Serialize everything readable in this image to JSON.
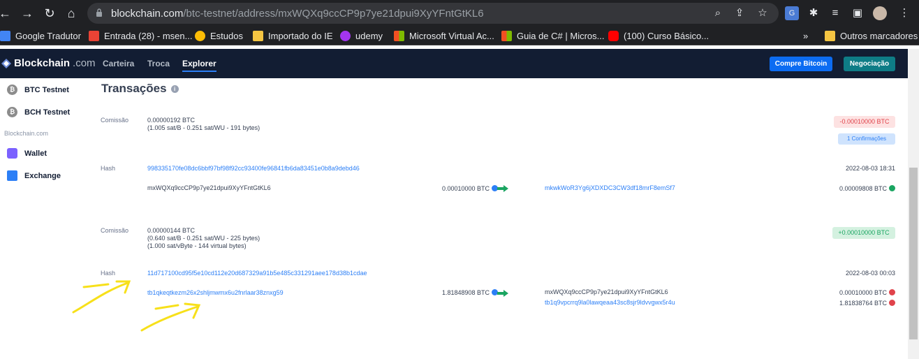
{
  "browser": {
    "url_domain": "blockchain.com",
    "url_path": "/btc-testnet/address/mxWQXq9ccCP9p7ye21dpui9XyYFntGtKL6",
    "bookmarks": [
      {
        "label": "Google Tradutor",
        "color": "#4285f4"
      },
      {
        "label": "Entrada (28) - msen...",
        "color": "#ea4335"
      },
      {
        "label": "Estudos",
        "color": "#fbbc05"
      },
      {
        "label": "Importado do IE",
        "color": "#f5c542"
      },
      {
        "label": "udemy",
        "color": "#a435f0"
      },
      {
        "label": "Microsoft Virtual Ac...",
        "color": "#f25022"
      },
      {
        "label": "Guia de C# | Micros...",
        "color": "#f25022"
      },
      {
        "label": "(100) Curso Básico...",
        "color": "#ff0000"
      }
    ],
    "more": "»",
    "other_bookmarks": "Outros marcadores"
  },
  "header": {
    "logo_a": "Blockchain",
    "logo_b": ".com",
    "nav": [
      "Carteira",
      "Troca",
      "Explorer"
    ],
    "btn_buy": "Compre Bitcoin",
    "btn_trade": "Negociação",
    "btn_buy_color": "#0c6cf2",
    "btn_trade_color": "#0e7c86"
  },
  "sidebar": {
    "items": [
      "BTC Testnet",
      "BCH Testnet"
    ],
    "section": "Blockchain.com",
    "links": [
      "Wallet",
      "Exchange"
    ]
  },
  "main": {
    "title": "Transações",
    "tx1": {
      "fee_label": "Comissão",
      "fee": "0.00000192 BTC",
      "fee_detail": "(1.005 sat/B - 0.251 sat/WU - 191 bytes)",
      "amount_badge": "-0.00010000 BTC",
      "confirmations": "1 Confirmações",
      "hash_label": "Hash",
      "hash": "998335170fe08dc6bbf97bf98f92cc93400fe96841fb6da83451e0b8a9debd46",
      "date": "2022-08-03 18:31",
      "input_addr": "mxWQXq9ccCP9p7ye21dpui9XyYFntGtKL6",
      "input_amount": "0.00010000 BTC",
      "output_addr": "mkwkWoR3Yg6jXDXDC3CW3df18mrF8emSf7",
      "output_amount": "0.00009808 BTC"
    },
    "tx2": {
      "fee_label": "Comissão",
      "fee": "0.00000144 BTC",
      "fee_detail1": "(0.640 sat/B - 0.251 sat/WU - 225 bytes)",
      "fee_detail2": "(1.000 sat/vByte - 144 virtual bytes)",
      "amount_badge": "+0.00010000 BTC",
      "hash_label": "Hash",
      "hash": "11d717100cd95f5e10cd112e20d687329a91b5e485c331291aee178d38b1cdae",
      "date": "2022-08-03 00:03",
      "input_addr": "tb1qkeqtkezm26x2shljmwmx6u2fnrlaar38znxg59",
      "input_amount": "1.81848908 BTC",
      "output_addr1": "mxWQXq9ccCP9p7ye21dpui9XyYFntGtKL6",
      "output_amount1": "0.00010000 BTC",
      "output_addr2": "tb1q9vpcrrq9la0lawqeaa43sc8sjr9ldvvgwx5r4u",
      "output_amount2": "1.81838764 BTC"
    }
  }
}
